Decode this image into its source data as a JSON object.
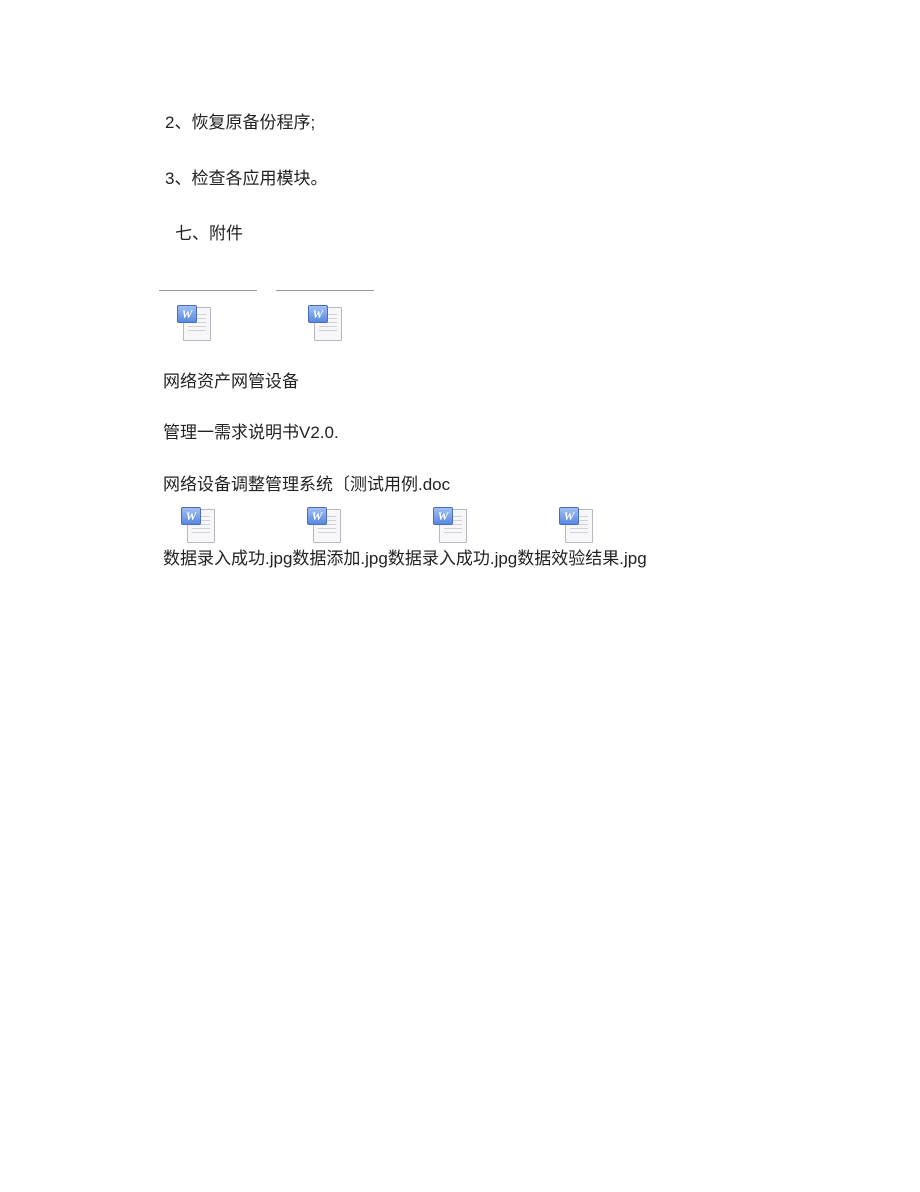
{
  "lines": {
    "l1": "2、恢复原备份程序;",
    "l2": "3、检查各应用模块。",
    "heading": "七、附件"
  },
  "attachments": {
    "line1": "网络资产网管设备",
    "line2": "管理一需求说明书V2.0.",
    "line3": "网络设备调整管理系统〔测试用例.doc",
    "row_label_1": "数据录入成功.jpg",
    "row_label_2": "数据添加.jpg",
    "row_label_3": "数据录入成功.jpg",
    "row_label_4": "数据效验结果.jpg"
  },
  "icon_glyph": "W"
}
